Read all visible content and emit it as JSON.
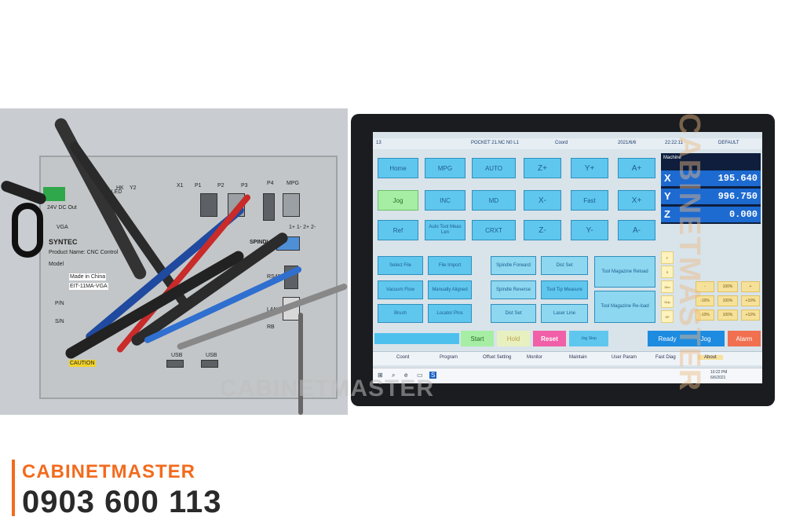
{
  "photo": {
    "brand": "SYNTEC",
    "product": "Product Name: CNC Control",
    "model_label": "Model",
    "model_value": "EIT-11MA-VGA",
    "made_in": "Made in China",
    "power_led": "Power LED",
    "power_spec": "24V DC Out",
    "vga": "VGA",
    "ports": [
      "HK",
      "Y2",
      "X1",
      "P1",
      "P2",
      "P3",
      "P4",
      "MPG"
    ],
    "spindle": "SPINDLE",
    "rs485": "RS485",
    "lan": "LAN",
    "rb": "RB",
    "usb1": "USB",
    "usb2": "USB",
    "caution": "CAUTION",
    "pin_label": "P/N",
    "sn_label": "S/N",
    "sub_ports": "1+ 1- 2+ 2-"
  },
  "hmi": {
    "title": {
      "program": "POCKET 21.NC N0 L1",
      "mode": "Coord",
      "date": "2021/6/6",
      "time": "22:22:11",
      "profile": "DEFAULT",
      "left": "13"
    },
    "buttons_row1": [
      "Home",
      "MPG",
      "AUTO",
      "Z+",
      "Y+",
      "A+"
    ],
    "buttons_row2": [
      "Jog",
      "INC",
      "MD",
      "X-",
      "Fast",
      "X+"
    ],
    "buttons_row3": [
      "Ref",
      "Auto Tool Meas Len",
      "CRXT",
      "Z-",
      "Y-",
      "A-"
    ],
    "left_col": [
      "Select File",
      "Vacuum Flow",
      "Brush"
    ],
    "mid_col": [
      "File Import",
      "Manually Aligned",
      "Locator Pins"
    ],
    "func_col1": [
      "Spindle Forward",
      "Spindle Reverse",
      "Dist Set"
    ],
    "func_col2": [
      "Dist Set",
      "Tool Tip Measure",
      "Laser Line"
    ],
    "func_col3": [
      "Tool Magazine Reload",
      "Tool Magazine Re-load"
    ],
    "machine": {
      "title": "Machine",
      "axes": [
        {
          "axis": "X",
          "value": "195.640"
        },
        {
          "axis": "Y",
          "value": "996.750"
        },
        {
          "axis": "Z",
          "value": "0.000"
        }
      ]
    },
    "override_labels": [
      "F",
      "S",
      "Dim",
      "Grip",
      "SP"
    ],
    "override_values": [
      "-",
      "100%",
      "+",
      "-10%",
      "100%",
      "+10%",
      "-10%",
      "100%",
      "+10%"
    ],
    "status": {
      "start": "Start",
      "hold": "Hold",
      "reset": "Reset",
      "cycle": "Jog Stop",
      "ready": "Ready",
      "jog": "Jog",
      "alarm": "Alarm"
    },
    "menu": [
      "Coord",
      "Program",
      "Offset Setting",
      "Monitor",
      "Maintain",
      "User Param",
      "Fast Diag",
      "About"
    ],
    "taskbar_time": "10:22 PM",
    "taskbar_date": "6/6/2021"
  },
  "watermark": "CABINETMASTER",
  "side_watermark": "CABINETMASTER",
  "footer": {
    "brand": "CABINETMASTER",
    "phone": "0903 600 113"
  },
  "colors": {
    "button": "#5fc7ee",
    "machine_panel": "#0e1e3c",
    "axis_row": "#1d6ad0",
    "brand_orange": "#f26b1d"
  }
}
